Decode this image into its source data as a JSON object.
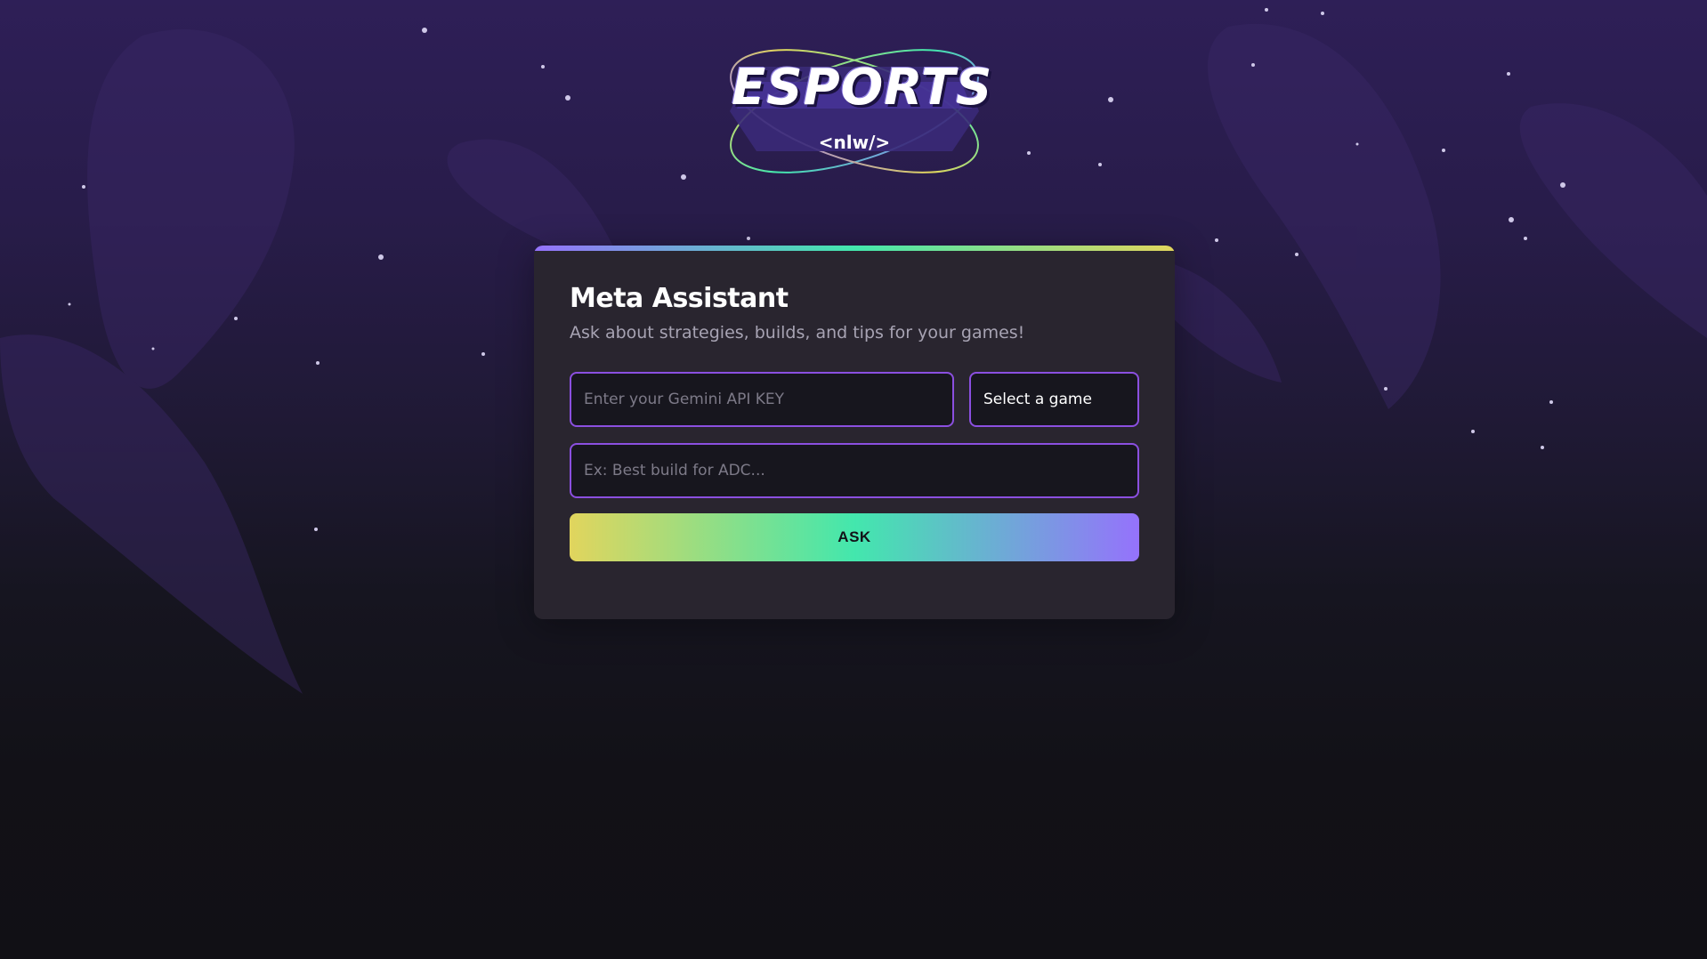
{
  "logo": {
    "wordmark": "ESPORTS",
    "tagline": "<nlw/>"
  },
  "card": {
    "title": "Meta Assistant",
    "subtitle": "Ask about strategies, builds, and tips for your games!"
  },
  "form": {
    "api_key_placeholder": "Enter your Gemini API KEY",
    "game_select_label": "Select a game",
    "question_placeholder": "Ex: Best build for ADC...",
    "ask_label": "ASK"
  },
  "colors": {
    "input_border": "#8b4fe0",
    "gradient_yellow": "#e1d55d",
    "gradient_green": "#43e7ad",
    "gradient_purple": "#9572fc",
    "card_bg": "#29252f"
  }
}
